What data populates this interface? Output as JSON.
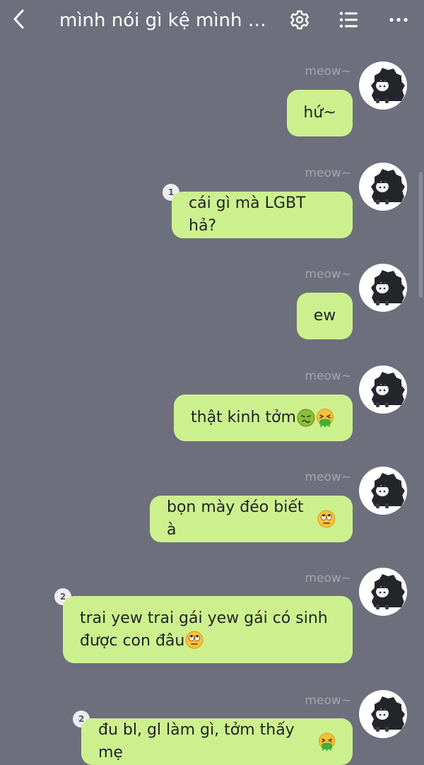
{
  "header": {
    "title": "mình nói gì kệ mình nh...",
    "back_icon": "chevron-left-icon",
    "settings_icon": "gear-icon",
    "menu_icon": "list-icon",
    "more_icon": "more-horizontal-icon"
  },
  "colors": {
    "background": "#6e6f7d",
    "bubble": "#cdf08f",
    "sender_text": "#a4a5ae"
  },
  "messages": [
    {
      "sender": "meow~",
      "text": "hứ~",
      "badge": ""
    },
    {
      "sender": "meow~",
      "text": "cái gì mà LGBT hả?",
      "badge": "1"
    },
    {
      "sender": "meow~",
      "text": "ew",
      "badge": ""
    },
    {
      "sender": "meow~",
      "text": "thật kinh tởm",
      "emojis": [
        "nauseated-face",
        "vomiting-face"
      ],
      "badge": ""
    },
    {
      "sender": "meow~",
      "text": "bọn mày đéo biết à",
      "emojis": [
        "eye-roll-face"
      ],
      "badge": ""
    },
    {
      "sender": "meow~",
      "line1": "trai yew trai gái yew gái có sinh",
      "line2": "được con đâu",
      "emojis": [
        "eye-roll-face"
      ],
      "badge": "2"
    },
    {
      "sender": "meow~",
      "text": "đu bl, gl làm gì, tởm thấy mẹ",
      "emojis": [
        "vomiting-face"
      ],
      "badge": "2"
    }
  ]
}
